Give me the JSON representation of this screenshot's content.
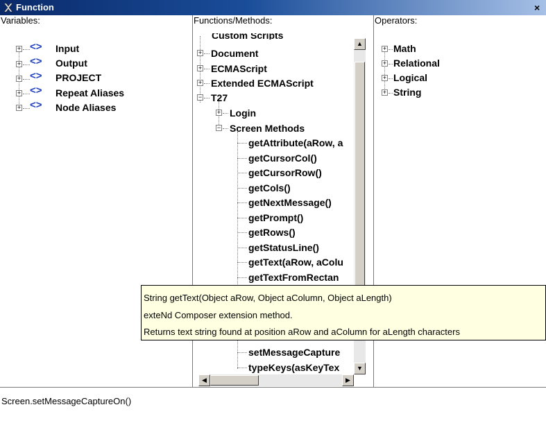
{
  "window": {
    "title": "Function",
    "close_glyph": "×"
  },
  "headers": {
    "variables": "Variables:",
    "functions": "Functions/Methods:",
    "operators": "Operators:"
  },
  "variables": [
    "Input",
    "Output",
    "PROJECT",
    "Repeat Aliases",
    "Node Aliases"
  ],
  "functions": {
    "partial_top": "Custom Scripts",
    "items": [
      "Document",
      "ECMAScript",
      "Extended ECMAScript",
      "T27"
    ],
    "t27_children": [
      "Login",
      "Screen Methods"
    ],
    "methods": [
      "getAttribute(aRow, a",
      "getCursorCol()",
      "getCursorRow()",
      "getCols()",
      "getNextMessage()",
      "getPrompt()",
      "getRows()",
      "getStatusLine()",
      "getText(aRow, aColu",
      "getTextFromRectan",
      "setMessageCapture",
      "typeKeys(asKeyTex"
    ]
  },
  "operators": [
    "Math",
    "Relational",
    "Logical",
    "String"
  ],
  "tooltip": {
    "line1": "String getText(Object aRow, Object aColumn, Object aLength)",
    "line2": "exteNd Composer extension method.",
    "line3": "Returns text string found at position aRow and aColumn for aLength characters"
  },
  "expression": "Screen.setMessageCaptureOn()",
  "icons": {
    "expand": "+",
    "collapse": "−",
    "variable": "<>"
  }
}
